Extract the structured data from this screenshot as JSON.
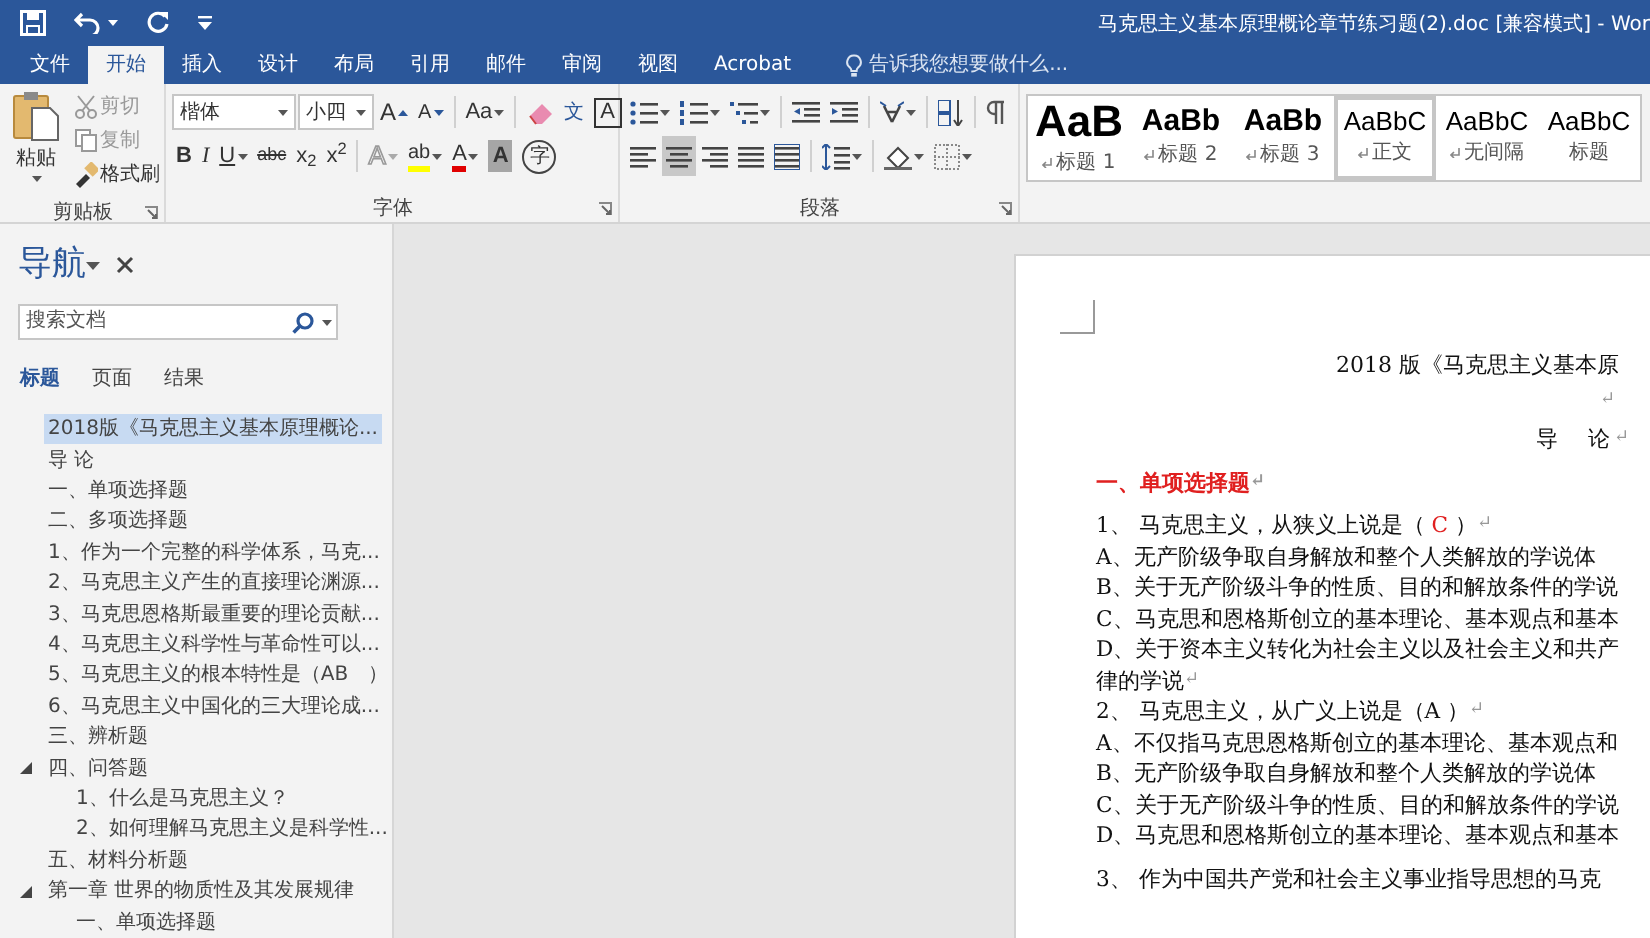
{
  "window": {
    "title": "马克思主义基本原理概论章节练习题(2).doc [兼容模式] - Wor"
  },
  "tabs": [
    {
      "label": "文件",
      "selected": false
    },
    {
      "label": "开始",
      "selected": true
    },
    {
      "label": "插入",
      "selected": false
    },
    {
      "label": "设计",
      "selected": false
    },
    {
      "label": "布局",
      "selected": false
    },
    {
      "label": "引用",
      "selected": false
    },
    {
      "label": "邮件",
      "selected": false
    },
    {
      "label": "审阅",
      "selected": false
    },
    {
      "label": "视图",
      "selected": false
    },
    {
      "label": "Acrobat",
      "selected": false
    }
  ],
  "tell_me": {
    "placeholder": "告诉我您想要做什么..."
  },
  "clipboard": {
    "paste": "粘贴",
    "group_label": "剪贴板",
    "items": [
      {
        "kind": "cut",
        "label": "剪切",
        "disabled": true
      },
      {
        "kind": "copy",
        "label": "复制",
        "disabled": true
      },
      {
        "kind": "painter",
        "label": "格式刷",
        "disabled": false
      }
    ]
  },
  "font": {
    "name": "楷体",
    "size": "小四",
    "group_label": "字体",
    "row1": [
      {
        "kind": "grow",
        "text": "A"
      },
      {
        "kind": "shrink",
        "text": "A"
      },
      {
        "kind": "case",
        "text": "Aa"
      },
      {
        "kind": "clear"
      },
      {
        "kind": "phonetic",
        "text": "文"
      },
      {
        "kind": "border",
        "text": "A"
      }
    ],
    "row2": [
      {
        "kind": "bold",
        "text": "B"
      },
      {
        "kind": "italic",
        "text": "I"
      },
      {
        "kind": "underline",
        "text": "U"
      },
      {
        "kind": "strike",
        "text": "abc"
      },
      {
        "kind": "script",
        "text": "x$_{2}$"
      },
      {
        "kind": "script",
        "text": "x$^{2}$"
      },
      {
        "kind": "effects",
        "text": "A"
      },
      {
        "kind": "highlight",
        "text": "ab"
      },
      {
        "kind": "color",
        "text": "A"
      },
      {
        "kind": "shade",
        "text": "A"
      },
      {
        "kind": "enclose",
        "text": "字"
      }
    ]
  },
  "paragraph": {
    "group_label": "段落",
    "align": [
      {
        "kind": "left",
        "selected": false
      },
      {
        "kind": "center",
        "selected": true
      },
      {
        "kind": "right",
        "selected": false
      },
      {
        "kind": "justify",
        "selected": false
      },
      {
        "kind": "distribute",
        "selected": false
      }
    ]
  },
  "styles": [
    {
      "kind": "heading1",
      "sample": "AaB",
      "name": "标题 1",
      "paragraph_mark": true,
      "selected": false
    },
    {
      "kind": "heading2",
      "sample": "AaBb",
      "name": "标题 2",
      "paragraph_mark": true,
      "selected": false
    },
    {
      "kind": "heading2",
      "sample": "AaBb",
      "name": "标题 3",
      "paragraph_mark": true,
      "selected": false
    },
    {
      "kind": "body",
      "sample": "AaBbC",
      "name": "正文",
      "paragraph_mark": true,
      "selected": true
    },
    {
      "kind": "body",
      "sample": "AaBbC",
      "name": "无间隔",
      "paragraph_mark": true,
      "selected": false
    },
    {
      "kind": "body",
      "sample": "AaBbC",
      "name": "标题",
      "paragraph_mark": false,
      "selected": false
    }
  ],
  "navigation": {
    "title": "导航",
    "search": {
      "placeholder": "搜索文档"
    },
    "tabs": [
      {
        "label": "标题",
        "selected": true
      },
      {
        "label": "页面",
        "selected": false
      },
      {
        "label": "结果",
        "selected": false
      }
    ],
    "tree": [
      {
        "text": "2018版《马克思主义基本原理概论...",
        "selected": true
      },
      {
        "text": "导 论",
        "selected": false
      },
      {
        "text": "一、单项选择题",
        "selected": false
      },
      {
        "text": "二、多项选择题",
        "selected": false
      },
      {
        "text": "1、作为一个完整的科学体系，马克...",
        "selected": false
      },
      {
        "text": "2、马克思主义产生的直接理论渊源...",
        "selected": false
      },
      {
        "text": "3、马克思恩格斯最重要的理论贡献...",
        "selected": false
      },
      {
        "text": "4、马克思主义科学性与革命性可以...",
        "selected": false
      },
      {
        "text": "5、马克思主义的根本特性是（AB　）",
        "selected": false
      },
      {
        "text": "6、马克思主义中国化的三大理论成...",
        "selected": false
      },
      {
        "text": "三、辨析题",
        "selected": false
      },
      {
        "text": "四、问答题",
        "selected": false,
        "expanded": true,
        "children": [
          {
            "text": "1、什么是马克思主义？",
            "selected": false
          },
          {
            "text": "2、如何理解马克思主义是科学性...",
            "selected": false
          }
        ]
      },
      {
        "text": "五、材料分析题",
        "selected": false
      },
      {
        "text": "第一章  世界的物质性及其发展规律",
        "selected": false,
        "expanded": true,
        "children": [
          {
            "text": "一、单项选择题",
            "selected": false
          }
        ]
      }
    ]
  },
  "document": {
    "lines": [
      {
        "kind": "title",
        "segments": [
          {
            "text": "2018 版《马克思主义基本原",
            "emphasis": false
          }
        ]
      },
      {
        "kind": "blank",
        "end_mark": "↵"
      },
      {
        "kind": "subtitle",
        "segments": [
          {
            "text": "导　论",
            "emphasis": false
          }
        ],
        "end_mark": "↵"
      },
      {
        "kind": "heading",
        "segments": [
          {
            "text": "一、单项选择题",
            "emphasis": true
          }
        ],
        "end_mark": "↵"
      },
      {
        "kind": "question",
        "segments": [
          {
            "text": "1、  马克思主义，从狭义上说是（ ",
            "emphasis": false
          },
          {
            "text": "C",
            "emphasis": true
          },
          {
            "text": " ）",
            "emphasis": false
          }
        ],
        "end_mark": "↵"
      },
      {
        "kind": "option",
        "segments": [
          {
            "text": "A、无产阶级争取自身解放和整个人类解放的学说体",
            "emphasis": false
          }
        ]
      },
      {
        "kind": "option",
        "segments": [
          {
            "text": "B、关于无产阶级斗争的性质、目的和解放条件的学说",
            "emphasis": false
          }
        ]
      },
      {
        "kind": "option",
        "segments": [
          {
            "text": "C、马克思和恩格斯创立的基本理论、基本观点和基本",
            "emphasis": false
          }
        ]
      },
      {
        "kind": "option",
        "segments": [
          {
            "text": "D、关于资本主义转化为社会主义以及社会主义和共产",
            "emphasis": false
          }
        ]
      },
      {
        "kind": "option",
        "segments": [
          {
            "text": "律的学说",
            "emphasis": false
          }
        ],
        "end_mark": "↵"
      },
      {
        "kind": "option",
        "segments": [
          {
            "text": "2、  马克思主义，从广义上说是（A  ）",
            "emphasis": false
          }
        ],
        "end_mark": "↵"
      },
      {
        "kind": "option",
        "segments": [
          {
            "text": "A、不仅指马克思恩格斯创立的基本理论、基本观点和",
            "emphasis": false
          }
        ]
      },
      {
        "kind": "option",
        "segments": [
          {
            "text": "B、无产阶级争取自身解放和整个人类解放的学说体",
            "emphasis": false
          }
        ]
      },
      {
        "kind": "option",
        "segments": [
          {
            "text": "C、关于无产阶级斗争的性质、目的和解放条件的学说",
            "emphasis": false
          }
        ]
      },
      {
        "kind": "option",
        "segments": [
          {
            "text": "D、马克思和恩格斯创立的基本理论、基本观点和基本",
            "emphasis": false
          }
        ]
      },
      {
        "kind": "question",
        "segments": [
          {
            "text": "3、  作为中国共产党和社会主义事业指导思想的马克",
            "emphasis": false
          }
        ]
      }
    ]
  }
}
